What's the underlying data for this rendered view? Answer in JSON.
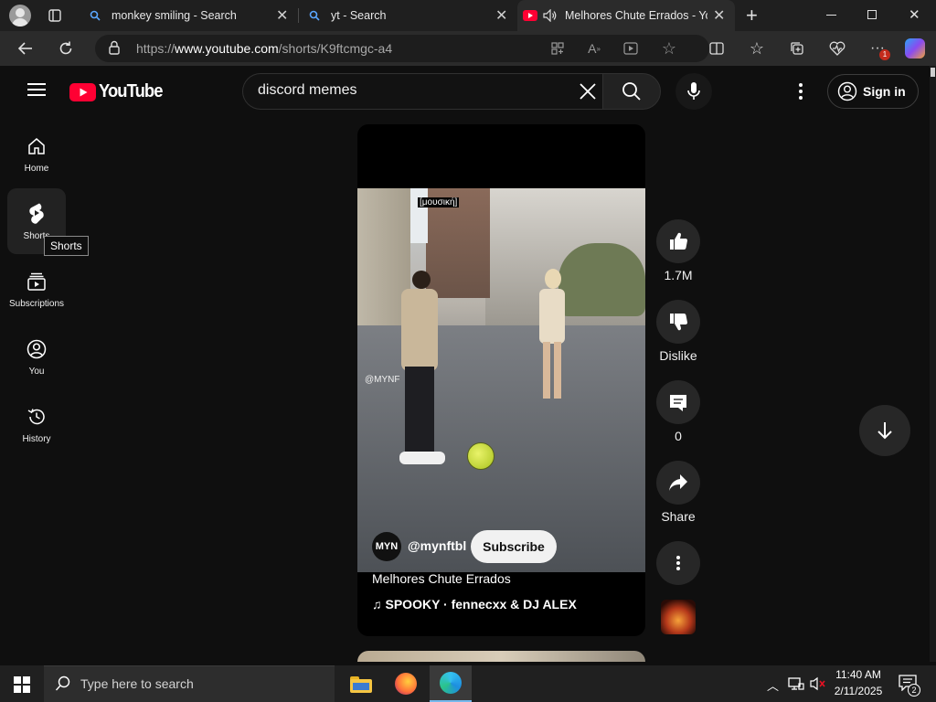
{
  "browser": {
    "tabs": [
      {
        "title": "monkey smiling - Search"
      },
      {
        "title": "yt - Search"
      },
      {
        "title": "Melhores Chute Errados - Yo"
      }
    ],
    "url": {
      "prefix": "https://",
      "domain": "www.youtube.com",
      "path": "/shorts/K9ftcmgc-a4"
    },
    "notification_count": "1"
  },
  "youtube": {
    "logo": "YouTube",
    "search_query": "discord memes",
    "sign_in": "Sign in",
    "sidebar": [
      {
        "label": "Home"
      },
      {
        "label": "Shorts"
      },
      {
        "label": "Subscriptions"
      },
      {
        "label": "You"
      },
      {
        "label": "History"
      }
    ],
    "tooltip": "Shorts",
    "short": {
      "overlay_text": "[μουσική]",
      "watermark": "@MYNF",
      "channel_avatar": "MYN",
      "channel": "@mynftbl",
      "subscribe": "Subscribe",
      "title": "Melhores Chute Errados",
      "music": "SPOOKY · fennecxx & DJ ALEX"
    },
    "actions": {
      "likes": "1.7M",
      "dislike": "Dislike",
      "comments": "0",
      "share": "Share"
    }
  },
  "taskbar": {
    "search_placeholder": "Type here to search",
    "time": "11:40 AM",
    "date": "2/11/2025",
    "notifications": "2"
  }
}
